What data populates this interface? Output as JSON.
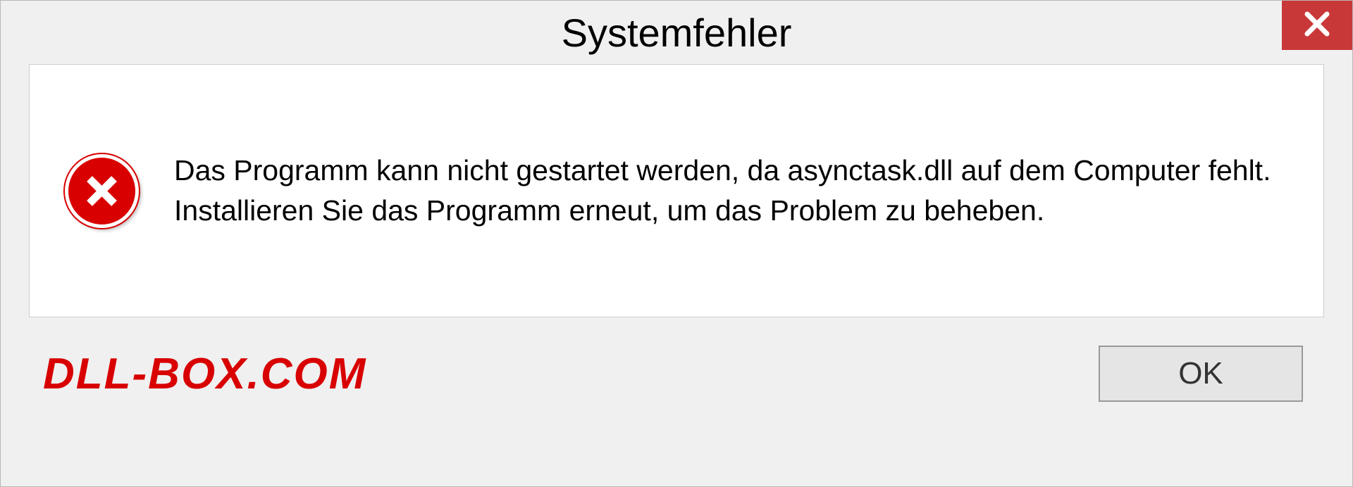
{
  "dialog": {
    "title": "Systemfehler",
    "message": "Das Programm kann nicht gestartet werden, da asynctask.dll auf dem Computer fehlt. Installieren Sie das Programm erneut, um das Problem zu beheben.",
    "ok_label": "OK"
  },
  "watermark": {
    "text": "DLL-BOX.COM"
  }
}
